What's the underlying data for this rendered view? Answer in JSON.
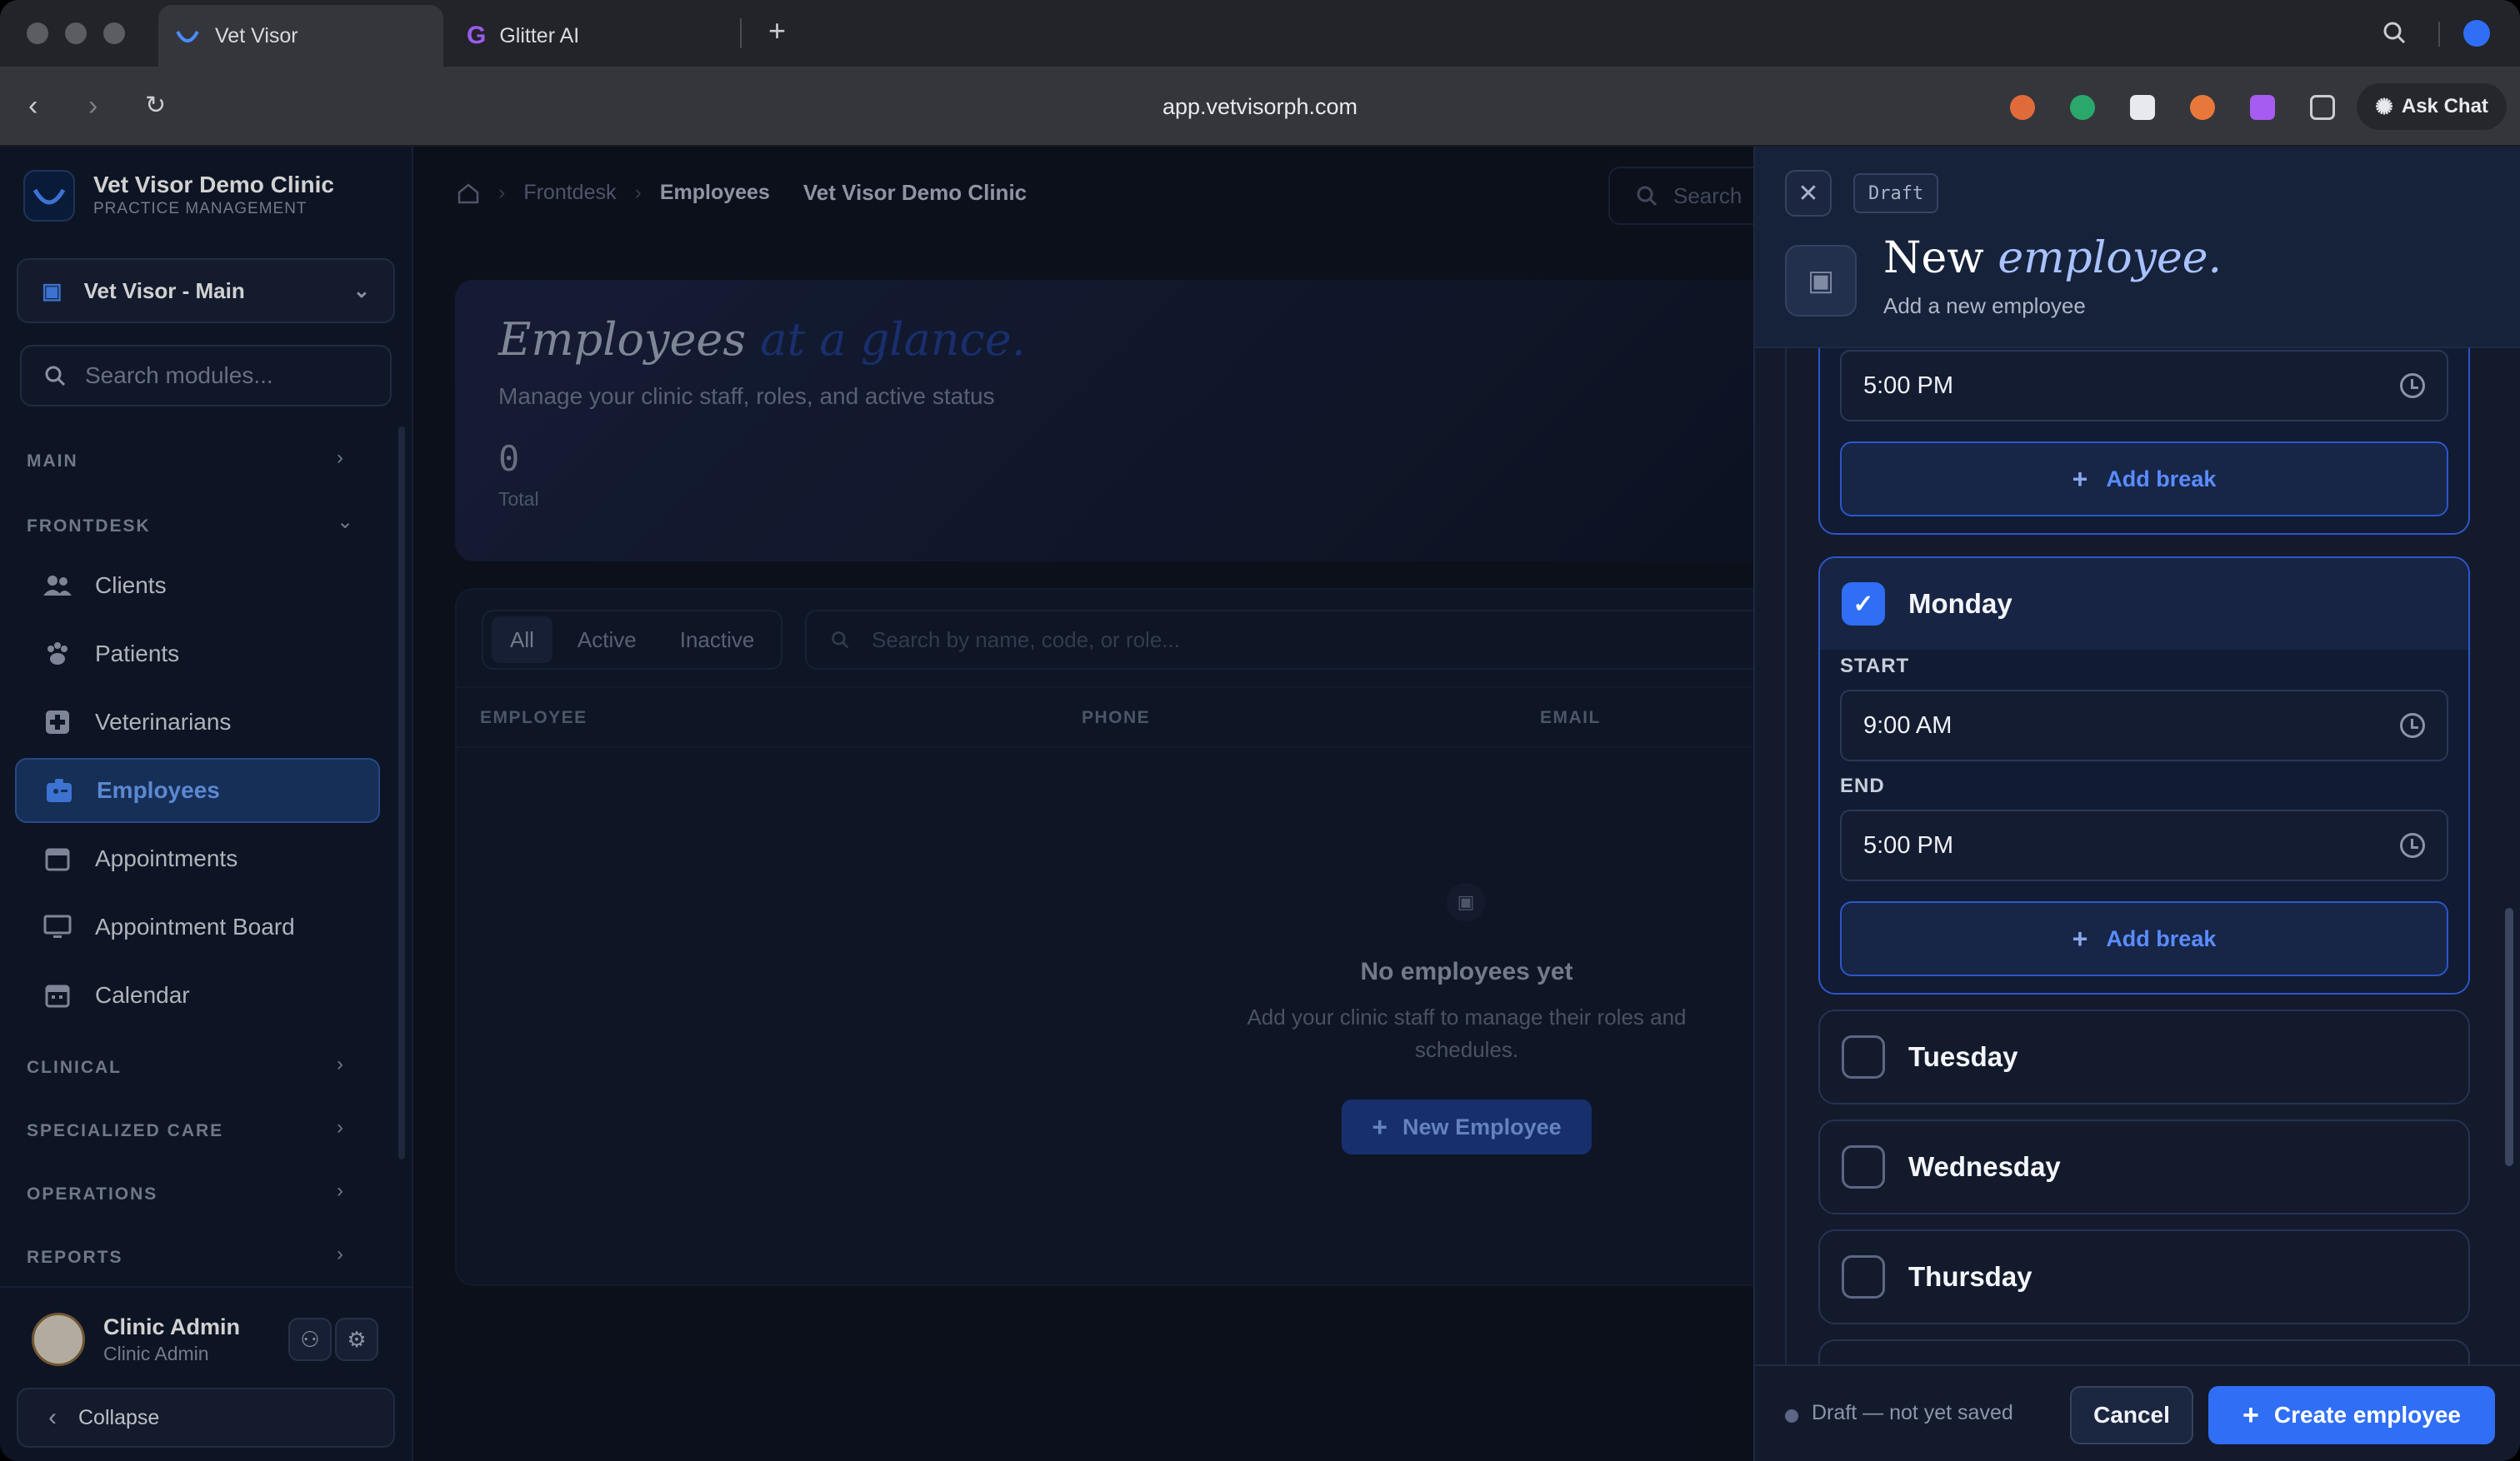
{
  "browser": {
    "tabs": [
      {
        "label": "Vet Visor",
        "active": true
      },
      {
        "label": "Glitter AI",
        "active": false
      }
    ],
    "new_tab_label": "+",
    "url": "app.vetvisorph.com",
    "ask_chat_label": "Ask Chat"
  },
  "sidebar": {
    "clinic_name": "Vet Visor Demo Clinic",
    "clinic_subtitle": "PRACTICE MANAGEMENT",
    "branch": "Vet Visor - Main",
    "search_placeholder": "Search modules...",
    "sections": {
      "main": "MAIN",
      "frontdesk": "FRONTDESK",
      "clinical": "CLINICAL",
      "specialized": "SPECIALIZED CARE",
      "operations": "OPERATIONS",
      "reports": "REPORTS"
    },
    "items": [
      {
        "label": "Clients",
        "icon": "people-icon"
      },
      {
        "label": "Patients",
        "icon": "paw-icon"
      },
      {
        "label": "Veterinarians",
        "icon": "medical-cross-icon"
      },
      {
        "label": "Employees",
        "icon": "id-badge-icon",
        "active": true
      },
      {
        "label": "Appointments",
        "icon": "calendar-check-icon"
      },
      {
        "label": "Appointment Board",
        "icon": "monitor-icon"
      },
      {
        "label": "Calendar",
        "icon": "calendar-icon"
      }
    ],
    "user": {
      "name": "Clinic Admin",
      "role": "Clinic Admin"
    },
    "collapse_label": "Collapse"
  },
  "main": {
    "breadcrumb": {
      "section": "Frontdesk",
      "current": "Employees",
      "clinic": "Vet Visor Demo Clinic"
    },
    "search_placeholder": "Search",
    "hero": {
      "title": "Employees",
      "title_accent": "at a glance.",
      "subtitle": "Manage your clinic staff, roles, and active status",
      "total_value": "0",
      "total_label": "Total"
    },
    "filters": [
      "All",
      "Active",
      "Inactive"
    ],
    "table_search_placeholder": "Search by name, code, or role...",
    "columns": [
      "EMPLOYEE",
      "PHONE",
      "EMAIL"
    ],
    "empty": {
      "title": "No employees yet",
      "subtitle": "Add your clinic staff to manage their roles and schedules.",
      "button": "New Employee"
    }
  },
  "drawer": {
    "badge": "Draft",
    "title": "New",
    "title_accent": "employee.",
    "subtitle": "Add a new employee",
    "schedule": {
      "prev_end_time": "5:00 PM",
      "add_break_label": "Add break",
      "start_label": "START",
      "end_label": "END",
      "days": [
        {
          "name": "Monday",
          "checked": true,
          "start": "9:00 AM",
          "end": "5:00 PM"
        },
        {
          "name": "Tuesday",
          "checked": false
        },
        {
          "name": "Wednesday",
          "checked": false
        },
        {
          "name": "Thursday",
          "checked": false
        }
      ]
    },
    "footer": {
      "status": "Draft — not yet saved",
      "cancel": "Cancel",
      "create": "Create employee"
    }
  },
  "colors": {
    "accent": "#2f6ef5",
    "sidebar_bg": "#111a2c",
    "main_bg": "#0e1422"
  }
}
